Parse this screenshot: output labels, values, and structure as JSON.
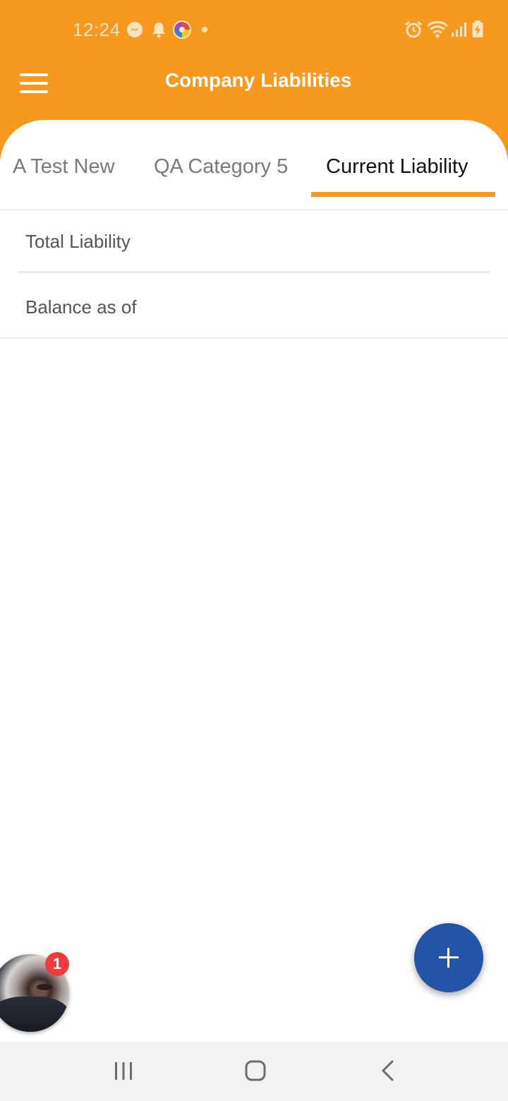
{
  "status_bar": {
    "time": "12:24",
    "left_icons": [
      "messenger-icon",
      "notification-bell-icon",
      "app-logo-icon",
      "dot-icon"
    ],
    "right_icons": [
      "alarm-icon",
      "wifi-icon",
      "signal-icon",
      "battery-charging-icon"
    ]
  },
  "app_bar": {
    "title": "Company Liabilities",
    "menu_icon": "hamburger-menu-icon",
    "background_color": "#F7981F"
  },
  "tabs": [
    {
      "label": "A Test New",
      "active": false
    },
    {
      "label": "QA Category 5",
      "active": false
    },
    {
      "label": "Current Liability",
      "active": true
    }
  ],
  "list": {
    "rows": [
      {
        "label": "Total Liability"
      },
      {
        "label": "Balance as of"
      }
    ]
  },
  "fab": {
    "icon": "plus-icon",
    "color": "#2454A8"
  },
  "chat_head": {
    "badge_count": "1",
    "badge_color": "#EF3B3B"
  },
  "nav_bar": {
    "buttons": [
      "recent-apps-icon",
      "home-icon",
      "back-icon"
    ]
  }
}
